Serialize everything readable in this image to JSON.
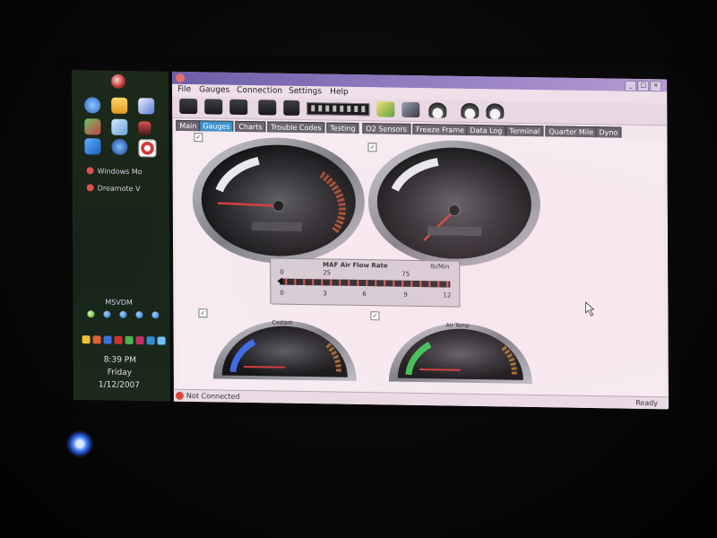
{
  "sidebar": {
    "tasks": [
      {
        "label": "Windows Mo"
      },
      {
        "label": "Dreamote V"
      }
    ],
    "title": "MSVDM",
    "clock": {
      "time": "8:39 PM",
      "day": "Friday",
      "date": "1/12/2007"
    }
  },
  "menu": [
    "File",
    "Gauges",
    "Connection",
    "Settings",
    "Help"
  ],
  "tabs": [
    "Main",
    "Gauges",
    "Charts",
    "Trouble Codes",
    "Testing",
    "O2 Sensors",
    "Freeze Frame",
    "Data Log",
    "Terminal",
    "Quarter Mile",
    "Dyno"
  ],
  "active_tab": "Gauges",
  "maf": {
    "title": "MAF Air Flow Rate",
    "unit": "lb/Min",
    "top_ticks": [
      "0",
      "25",
      "75"
    ],
    "bottom_ticks": [
      "0",
      "3",
      "6",
      "9",
      "12"
    ]
  },
  "gauges": {
    "coolant_label": "Coolant",
    "airtemp_label": "Air Temp"
  },
  "status": {
    "left": "Not Connected",
    "right": "Ready"
  },
  "colors": {
    "active_tab": "#3c94cf",
    "maf_ticks": "#e05050",
    "power_led": "#3a78ff"
  }
}
